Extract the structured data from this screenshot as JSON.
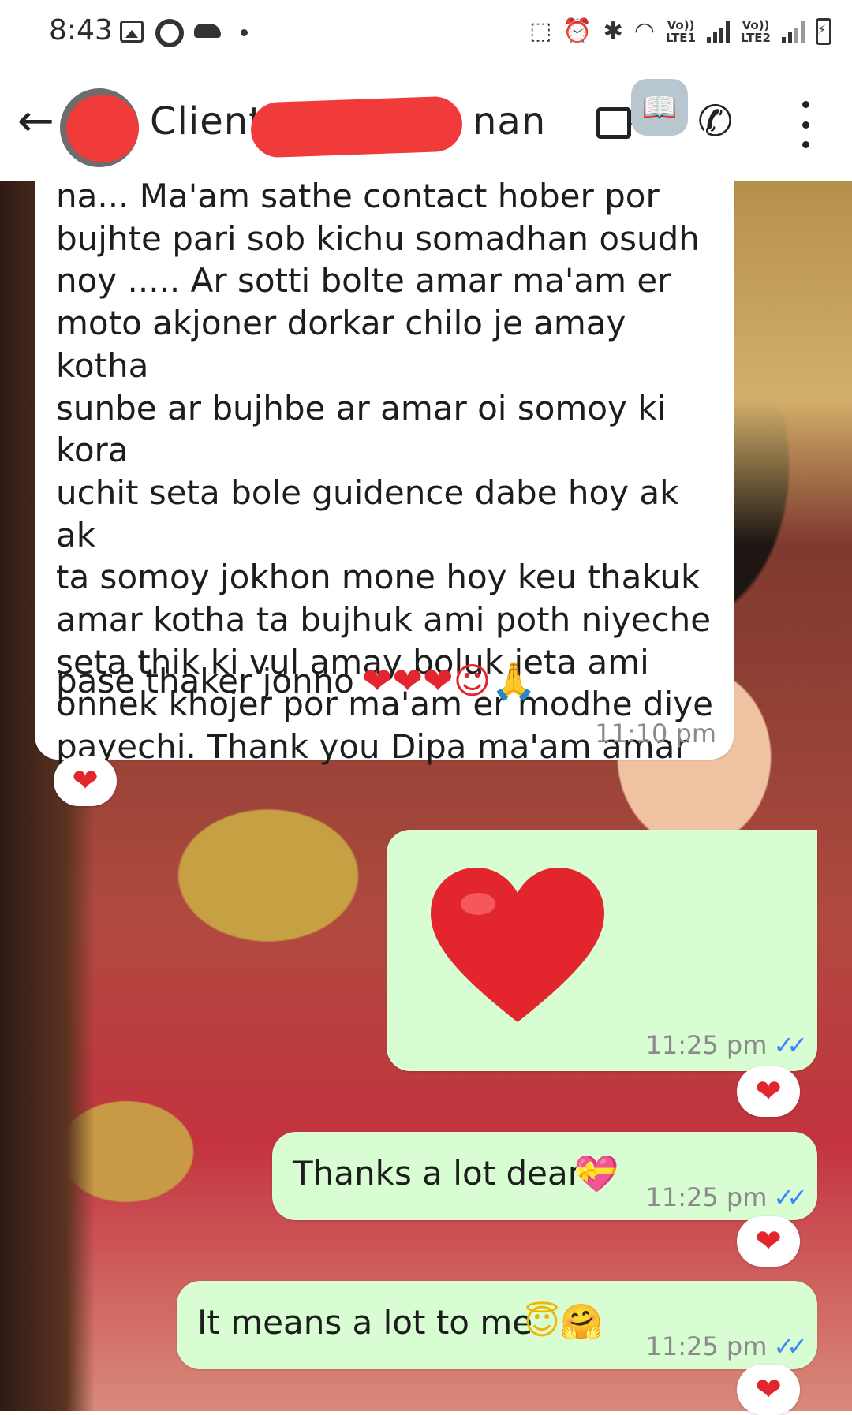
{
  "status_bar": {
    "time": "8:43",
    "sim1_label": "Vo))\nLTE1",
    "sim2_label": "Vo))\nLTE2"
  },
  "app_bar": {
    "contact_name_visible_start": "Client",
    "contact_name_visible_end": "nan",
    "icons": [
      "back-arrow-icon",
      "video-call-icon",
      "book-icon",
      "voice-call-icon",
      "more-options-icon"
    ]
  },
  "messages": [
    {
      "direction": "incoming",
      "text": "na... Ma'am sathe contact hober por\nbujhte pari sob kichu somadhan osudh\nnoy ..... Ar sotti bolte amar ma'am er\nmoto akjoner dorkar chilo je amay kotha\nsunbe ar bujhbe ar amar oi somoy ki kora\nuchit seta bole guidence dabe hoy ak ak\nta somoy jokhon mone hoy keu thakuk\namar kotha ta bujhuk ami poth niyeche\nseta thik ki vul amay boluk jeta ami\nonnek khojer por ma'am er modhe diye\npayechi. Thank you Dipa ma'am amar",
      "last_line": "pase thaker jonno",
      "emojis": "❤❤❤☺🙏",
      "time": "11:10 pm",
      "reaction": "❤"
    },
    {
      "direction": "outgoing",
      "text": "",
      "emoji_only": "❤",
      "time": "11:25 pm",
      "ticks": "✓✓",
      "reaction": "❤"
    },
    {
      "direction": "outgoing",
      "text": "Thanks a lot dear",
      "emojis": "💝",
      "time": "11:25 pm",
      "ticks": "✓✓",
      "reaction": "❤"
    },
    {
      "direction": "outgoing",
      "text": "It means a lot to me",
      "emojis": "😇🤗",
      "time": "11:25 pm",
      "ticks": "✓✓",
      "reaction": "❤"
    }
  ],
  "colors": {
    "incoming_bubble": "#ffffff",
    "outgoing_bubble": "#d9fdd3",
    "read_ticks": "#3b87f5",
    "reaction_heart": "#e3262d",
    "redaction": "#f13b3b"
  }
}
